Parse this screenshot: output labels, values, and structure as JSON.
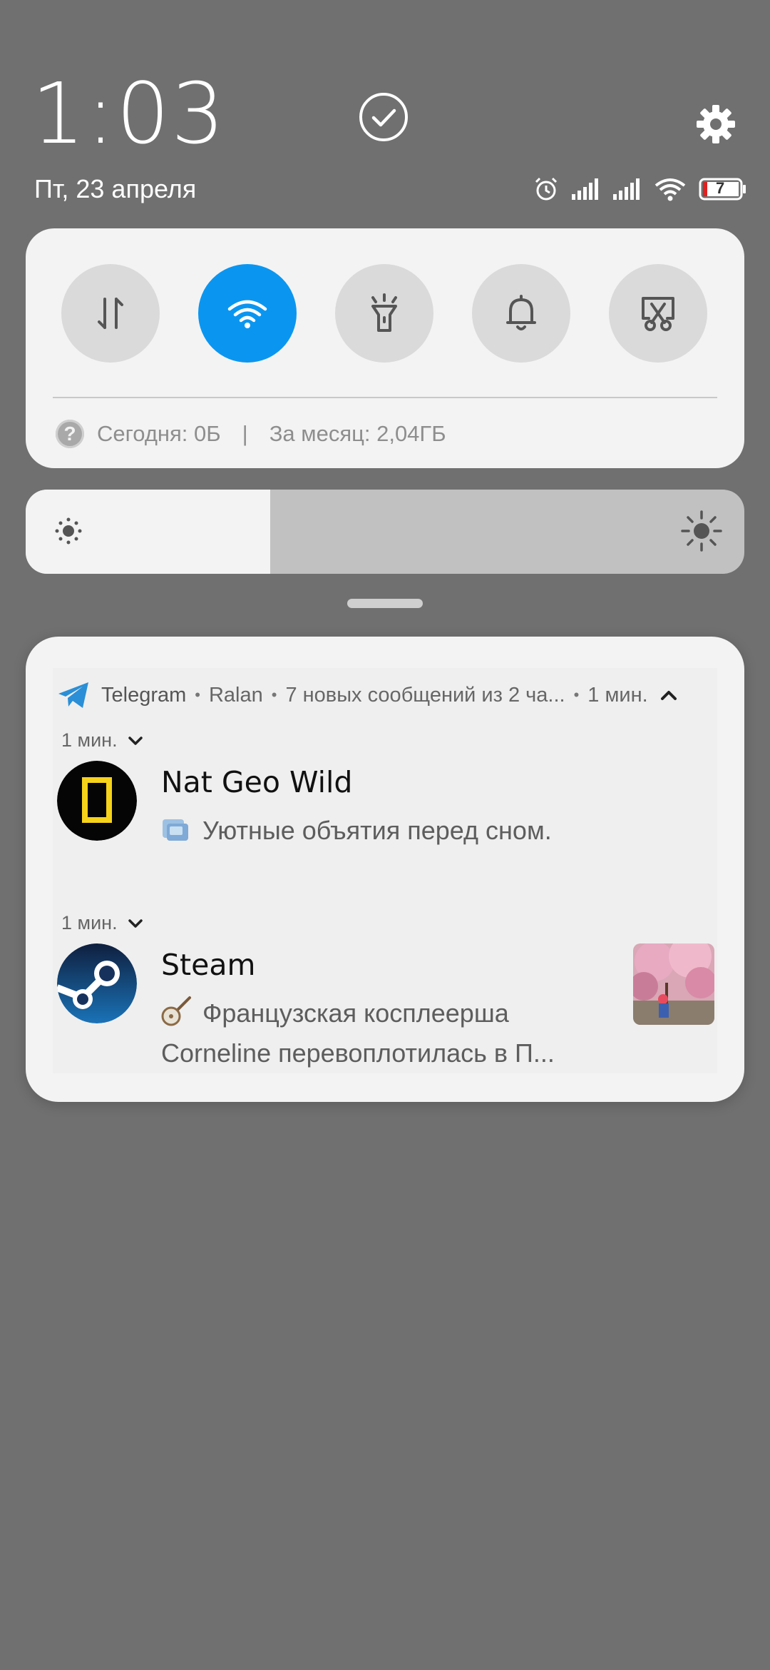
{
  "status_bar": {
    "time": "1:03",
    "date": "Пт, 23 апреля",
    "battery_level": "7",
    "icons": [
      "check-circle-icon",
      "gear-icon",
      "alarm-icon",
      "signal-icon",
      "signal-icon",
      "wifi-icon",
      "battery-icon"
    ]
  },
  "quick_settings": {
    "toggles": [
      {
        "name": "mobile-data",
        "icon": "data-arrows-icon",
        "active": false
      },
      {
        "name": "wifi",
        "icon": "wifi-icon",
        "active": true
      },
      {
        "name": "flashlight",
        "icon": "flashlight-icon",
        "active": false
      },
      {
        "name": "sound",
        "icon": "bell-icon",
        "active": false
      },
      {
        "name": "screenshot",
        "icon": "screenshot-icon",
        "active": false
      }
    ],
    "data_usage": {
      "today": "Сегодня: 0Б",
      "separator": "|",
      "month": "За месяц: 2,04ГБ"
    },
    "accent_color": "#0a96f0"
  },
  "brightness": {
    "level": 0.34
  },
  "notification": {
    "app": "Telegram",
    "account": "Ralan",
    "summary": "7 новых сообщений из 2 ча...",
    "time": "1 мин.",
    "messages": [
      {
        "time": "1 мин.",
        "sender": "Nat Geo Wild",
        "text": "Уютные объятия перед сном.",
        "emoji_icon": "video-camera-icon"
      },
      {
        "time": "1 мин.",
        "sender": "Steam",
        "text_line1": "Французская косплеерша",
        "text_line2": "Corneline перевоплотилась в П...",
        "emoji_icon": "banjo-icon"
      }
    ]
  }
}
